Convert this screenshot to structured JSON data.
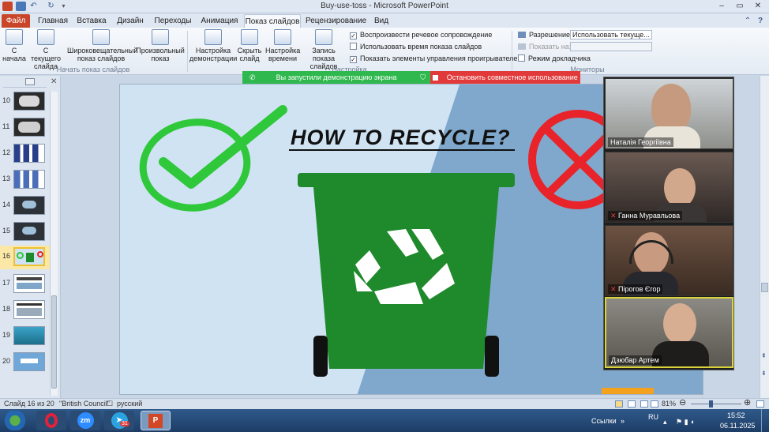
{
  "window": {
    "title": "Buy-use-toss  -  Microsoft PowerPoint"
  },
  "tabs": [
    {
      "label": "Файл"
    },
    {
      "label": "Главная"
    },
    {
      "label": "Вставка"
    },
    {
      "label": "Дизайн"
    },
    {
      "label": "Переходы"
    },
    {
      "label": "Анимация"
    },
    {
      "label": "Показ слайдов"
    },
    {
      "label": "Рецензирование"
    },
    {
      "label": "Вид"
    }
  ],
  "ribbon": {
    "from_start": "С начала",
    "from_current": "С текущего слайда",
    "broadcast": "Широковещательный показ слайдов",
    "custom_show": "Произвольный показ",
    "group_start": "Начать показ слайдов",
    "setup_show": "Настройка демонстрации",
    "hide_slide": "Скрыть слайд",
    "rehearse": "Настройка времени",
    "record": "Запись показа слайдов",
    "group_setup": "Настройка",
    "chk_narration": "Воспроизвести речевое сопровождение",
    "chk_timings": "Использовать время показа слайдов",
    "chk_controls": "Показать элементы управления проигрывателем",
    "resolution_label": "Разрешение:",
    "resolution_value": "Использовать текуще...",
    "show_on_label": "Показать на:",
    "presenter_view": "Режим докладчика",
    "group_monitors": "Мониторы"
  },
  "share": {
    "started": "Вы запустили демонстрацию экрана",
    "stop": "Остановить совместное использование"
  },
  "slides": {
    "numbers": [
      "10",
      "11",
      "12",
      "13",
      "14",
      "15",
      "16",
      "17",
      "18",
      "19",
      "20"
    ],
    "selected": "16"
  },
  "slide": {
    "title": "HOW TO RECYCLE?"
  },
  "participants": [
    {
      "name": "Наталія Георгіївна"
    },
    {
      "name": "Ганна Муравльова"
    },
    {
      "name": "Пірогов Єгор"
    },
    {
      "name": "Дзюбар Артем"
    }
  ],
  "status": {
    "slide_counter": "Слайд 16 из 20",
    "theme": "\"British Council\"",
    "language": "русский",
    "zoom": "81%"
  },
  "taskbar": {
    "links": "Ссылки",
    "lang": "RU",
    "time": "15:52",
    "date": "06.11.2025",
    "telegram_badge": "31"
  },
  "colors": {
    "file_tab": "#c8452a",
    "share_green": "#2fb84d",
    "share_red": "#e23a3a",
    "bin_green": "#1f8a2c",
    "check_green": "#2ec83a",
    "cross_red": "#e8232a",
    "speaker_border": "#d9d43a"
  }
}
